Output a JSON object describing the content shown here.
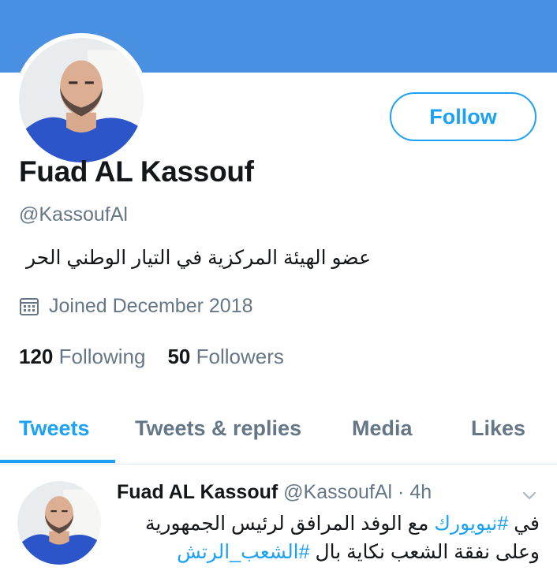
{
  "colors": {
    "accent": "#1da1f2",
    "banner": "#4a90e2",
    "muted": "#657786",
    "text": "#14171a"
  },
  "profile": {
    "name": "Fuad AL Kassouf",
    "handle": "@KassoufAl",
    "bio": "عضو الهيئة المركزية في التيار الوطني الحر",
    "joined": "Joined December 2018",
    "follow_label": "Follow",
    "following_count": "120",
    "following_label": "Following",
    "followers_count": "50",
    "followers_label": "Followers",
    "icons": {
      "joined": "calendar-icon"
    }
  },
  "tabs": [
    {
      "label": "Tweets",
      "active": true
    },
    {
      "label": "Tweets & replies",
      "active": false
    },
    {
      "label": "Media",
      "active": false
    },
    {
      "label": "Likes",
      "active": false
    }
  ],
  "tweet": {
    "name": "Fuad AL Kassouf",
    "handle": "@KassoufAl",
    "separator": "·",
    "time": "4h",
    "line1_prefix": "في ",
    "line1_hashtag": "#نيويورك",
    "line1_rest": " مع الوفد المرافق لرئيس الجمهورية",
    "line2_text": "وعلى نفقة الشعب نكاية بال ",
    "line2_hashtag": "#الشعب_الرتش",
    "icons": {
      "menu": "chevron-down-icon"
    }
  }
}
